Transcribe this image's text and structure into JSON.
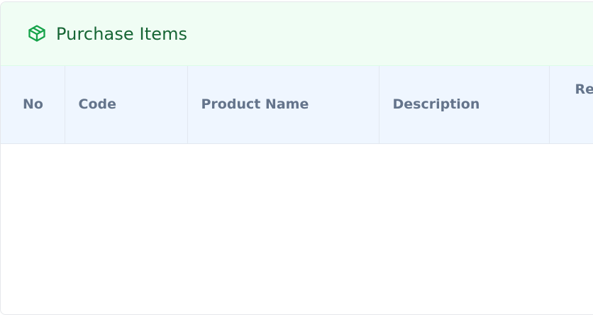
{
  "panel": {
    "title": "Purchase Items",
    "icon": "package-icon",
    "accent_color": "#16a34a",
    "title_color": "#166534",
    "header_bg": "#f0fdf4"
  },
  "table": {
    "header_bg": "#eff6ff",
    "columns": [
      {
        "key": "no",
        "label": "No"
      },
      {
        "key": "code",
        "label": "Code"
      },
      {
        "key": "product_name",
        "label": "Product Name"
      },
      {
        "key": "description",
        "label": "Description"
      },
      {
        "key": "remarks",
        "label": "Re"
      }
    ],
    "rows": []
  }
}
